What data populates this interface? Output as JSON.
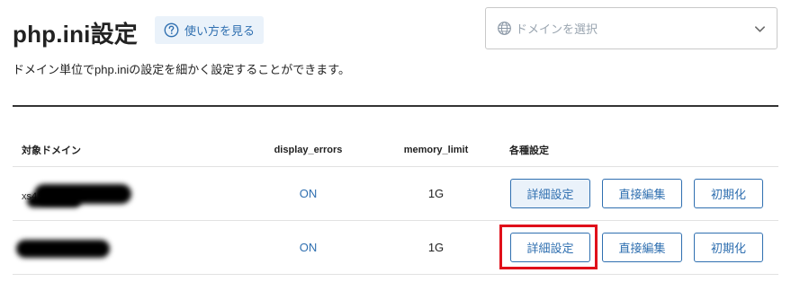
{
  "header": {
    "title": "php.ini設定",
    "help_label": "使い方を見る",
    "description": "ドメイン単位でphp.iniの設定を細かく設定することができます。"
  },
  "domain_select": {
    "placeholder": "ドメインを選択",
    "icon": "globe-icon"
  },
  "table": {
    "columns": [
      "対象ドメイン",
      "display_errors",
      "memory_limit",
      "各種設定"
    ],
    "rows": [
      {
        "domain_visible_prefix": "xs4",
        "display_errors": "ON",
        "memory_limit": "1G",
        "actions": [
          "詳細設定",
          "直接編集",
          "初期化"
        ]
      },
      {
        "domain_visible_prefix": "",
        "display_errors": "ON",
        "memory_limit": "1G",
        "actions": [
          "詳細設定",
          "直接編集",
          "初期化"
        ]
      }
    ]
  },
  "colors": {
    "accent": "#2f6fb0",
    "highlight": "#e0101a",
    "rule": "#333333"
  }
}
